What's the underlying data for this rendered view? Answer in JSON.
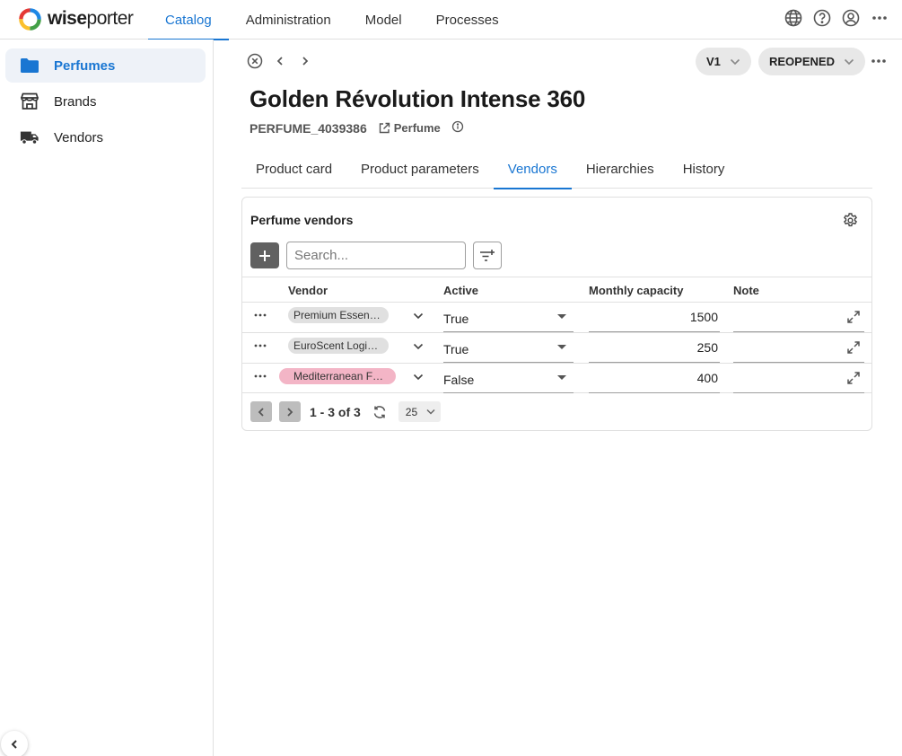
{
  "app": {
    "logo_text_bold": "wise",
    "logo_text_light": "porter",
    "brand_colors": [
      "#e53935",
      "#fbc02d",
      "#43a047",
      "#1e88e5"
    ]
  },
  "topnav": {
    "items": [
      {
        "label": "Catalog",
        "active": true
      },
      {
        "label": "Administration",
        "active": false
      },
      {
        "label": "Model",
        "active": false
      },
      {
        "label": "Processes",
        "active": false
      }
    ],
    "icons": [
      "globe-icon",
      "help-icon",
      "account-icon",
      "more-icon"
    ]
  },
  "sidebar": {
    "items": [
      {
        "label": "Perfumes",
        "icon": "folder-icon",
        "active": true
      },
      {
        "label": "Brands",
        "icon": "store-icon",
        "active": false
      },
      {
        "label": "Vendors",
        "icon": "truck-icon",
        "active": false
      }
    ]
  },
  "record": {
    "version": "V1",
    "status": "REOPENED",
    "title": "Golden Révolution Intense 360",
    "code": "PERFUME_4039386",
    "type": "Perfume"
  },
  "tabs": [
    {
      "label": "Product card",
      "active": false
    },
    {
      "label": "Product parameters",
      "active": false
    },
    {
      "label": "Vendors",
      "active": true
    },
    {
      "label": "Hierarchies",
      "active": false
    },
    {
      "label": "History",
      "active": false
    }
  ],
  "vendors_table": {
    "title": "Perfume vendors",
    "search_placeholder": "Search...",
    "columns": [
      "Vendor",
      "Active",
      "Monthly capacity",
      "Note"
    ],
    "rows": [
      {
        "vendor": "Premium Essen…",
        "active": "True",
        "capacity": "1500",
        "note": "",
        "highlight": false
      },
      {
        "vendor": "EuroScent Logis…",
        "active": "True",
        "capacity": "250",
        "note": "",
        "highlight": false
      },
      {
        "vendor": "Mediterranean F…",
        "active": "False",
        "capacity": "400",
        "note": "",
        "highlight": true
      }
    ],
    "pagination": {
      "range_text": "1 - 3 of 3",
      "page_size": "25"
    }
  },
  "colors": {
    "accent": "#1976d2",
    "chip_default": "#e0e0e0",
    "chip_warn": "#f3b5c6"
  }
}
